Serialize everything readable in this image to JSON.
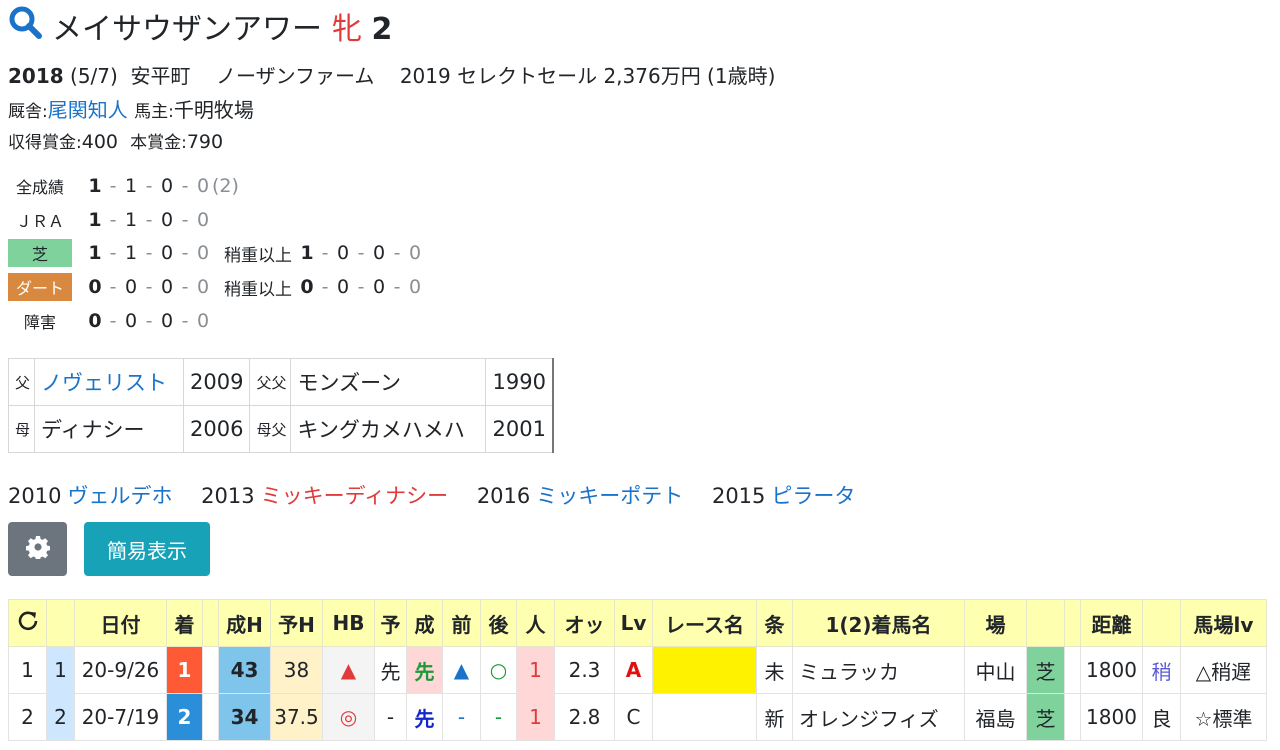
{
  "horse": {
    "name": "メイサウザンアワー",
    "sex": "牝",
    "age": "2"
  },
  "profile": {
    "year": "2018",
    "birthdate": "(5/7)",
    "region": "安平町",
    "breeder": "ノーザンファーム",
    "sale": "2019 セレクトセール 2,376万円 (1歳時)",
    "stable_label": "厩舎:",
    "trainer": "尾関知人",
    "owner_label": "馬主:",
    "owner": "千明牧場",
    "earned_label": "収得賞金:",
    "earned": "400",
    "main_label": "本賞金:",
    "main": "790"
  },
  "records": [
    {
      "label": "全成績",
      "vals": [
        "1",
        "1",
        "0",
        "0"
      ],
      "extra": "(2)"
    },
    {
      "label": "ＪＲＡ",
      "vals": [
        "1",
        "1",
        "0",
        "0"
      ]
    },
    {
      "label": "芝",
      "vals": [
        "1",
        "1",
        "0",
        "0"
      ],
      "sub_label": "稍重以上",
      "sub_vals": [
        "1",
        "0",
        "0",
        "0"
      ]
    },
    {
      "label": "ダート",
      "vals": [
        "0",
        "0",
        "0",
        "0"
      ],
      "sub_label": "稍重以上",
      "sub_vals": [
        "0",
        "0",
        "0",
        "0"
      ]
    },
    {
      "label": "障害",
      "vals": [
        "0",
        "0",
        "0",
        "0"
      ]
    }
  ],
  "pedigree": [
    {
      "k1": "父",
      "name": "ノヴェリスト",
      "year": "2009",
      "k2": "父父",
      "gname": "モンズーン",
      "gyear": "1990"
    },
    {
      "k1": "母",
      "name": "ディナシー",
      "year": "2006",
      "k2": "母父",
      "gname": "キングカメハメハ",
      "gyear": "2001"
    }
  ],
  "siblings": [
    {
      "year": "2010",
      "name": "ヴェルデホ",
      "color": "blue"
    },
    {
      "year": "2013",
      "name": "ミッキーディナシー",
      "color": "red"
    },
    {
      "year": "2016",
      "name": "ミッキーポテト",
      "color": "blue"
    },
    {
      "year": "2015",
      "name": "ピラータ",
      "color": "blue"
    }
  ],
  "buttons": {
    "simple": "簡易表示"
  },
  "table": {
    "headers": [
      "",
      "",
      "日付",
      "着",
      "",
      "成H",
      "予H",
      "HB",
      "予",
      "成",
      "前",
      "後",
      "人",
      "オッ",
      "Lv",
      "レース名",
      "条",
      "1(2)着馬名",
      "場",
      "",
      "",
      "距離",
      "",
      "馬場lv"
    ],
    "rows": [
      [
        "1",
        "1",
        "20-9/26",
        "1",
        "",
        "43",
        "38",
        "▲",
        "先",
        "先",
        "▲",
        "○",
        "1",
        "2.3",
        "A",
        "",
        "未",
        "ミュラッカ",
        "中山",
        "芝",
        "",
        "1800",
        "稍",
        "△稍遅"
      ],
      [
        "2",
        "2",
        "20-7/19",
        "2",
        "",
        "34",
        "37.5",
        "◎",
        "-",
        "先",
        "-",
        "-",
        "1",
        "2.8",
        "C",
        "",
        "新",
        "オレンジフィズ",
        "福島",
        "芝",
        "",
        "1800",
        "良",
        "☆標準"
      ]
    ]
  },
  "colors": {
    "accent": "#1a73c9",
    "red": "#e03b3b",
    "header_bg": "#ffffb0"
  }
}
